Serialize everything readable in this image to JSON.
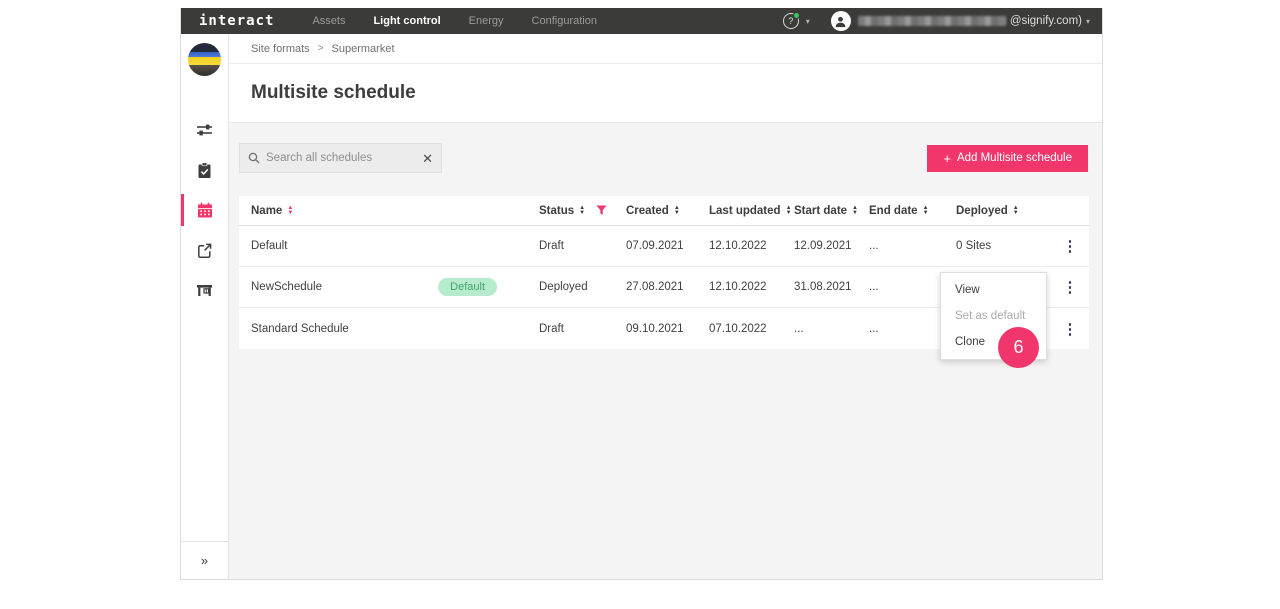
{
  "app": {
    "brand": "interact",
    "nav": {
      "items": [
        {
          "label": "Assets",
          "active": false
        },
        {
          "label": "Light control",
          "active": true
        },
        {
          "label": "Energy",
          "active": false
        },
        {
          "label": "Configuration",
          "active": false
        }
      ]
    },
    "user": {
      "email_suffix": "@signify.com)",
      "help_glyph": "?"
    }
  },
  "sidebar": {
    "icons": [
      "site-logo",
      "tune-icon",
      "clipboard-check-icon",
      "calendar-icon",
      "open-in-new-icon",
      "store-shelf-icon"
    ],
    "active_icon": "calendar-icon",
    "collapse_glyph": "»"
  },
  "breadcrumb": {
    "items": [
      "Site formats",
      "Supermarket"
    ],
    "separator": ">"
  },
  "page": {
    "title": "Multisite schedule"
  },
  "toolbar": {
    "search_placeholder": "Search all schedules",
    "clear_glyph": "✕",
    "add_plus": "+",
    "add_button_label": "Add Multisite schedule"
  },
  "table": {
    "columns": [
      "Name",
      "Status",
      "Created",
      "Last updated",
      "Start date",
      "End date",
      "Deployed"
    ],
    "rows": [
      {
        "name": "Default",
        "badge": "",
        "status": "Draft",
        "created": "07.09.2021",
        "last_updated": "12.10.2022",
        "start_date": "12.09.2021",
        "end_date": "...",
        "deployed": "0 Sites"
      },
      {
        "name": "NewSchedule",
        "badge": "Default",
        "status": "Deployed",
        "created": "27.08.2021",
        "last_updated": "12.10.2022",
        "start_date": "31.08.2021",
        "end_date": "...",
        "deployed": ""
      },
      {
        "name": "Standard Schedule",
        "badge": "",
        "status": "Draft",
        "created": "09.10.2021",
        "last_updated": "07.10.2022",
        "start_date": "...",
        "end_date": "...",
        "deployed": ""
      }
    ],
    "kebab_glyph": "⋮"
  },
  "context_menu": {
    "items": [
      {
        "label": "View",
        "enabled": true
      },
      {
        "label": "Set as default",
        "enabled": false
      },
      {
        "label": "Clone",
        "enabled": true
      }
    ]
  },
  "annotation": {
    "number": "6"
  },
  "colors": {
    "accent_pink": "#f1366b",
    "nav_bg": "#3b3b3a",
    "badge_bg": "#b6eccd",
    "badge_text": "#43a56f",
    "content_bg": "#f4f4f4",
    "help_badge_green": "#35c759"
  }
}
